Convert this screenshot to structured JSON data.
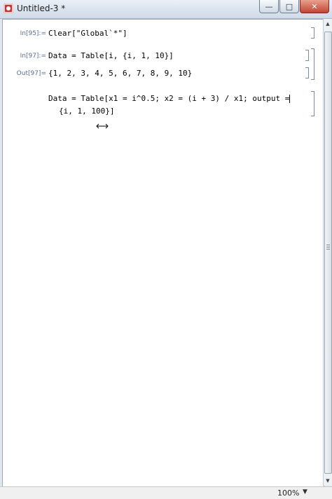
{
  "window": {
    "title": "Untitled-3 *"
  },
  "controls": {
    "minimize": "—",
    "maximize": "□",
    "close": "✕"
  },
  "cells": [
    {
      "label": "In[95]:=",
      "code": "Clear[\"Global`*\"]"
    },
    {
      "label": "In[97]:=",
      "code": "Data = Table[i, {i, 1, 10}]"
    },
    {
      "label": "Out[97]=",
      "code": "{1, 2, 3, 4, 5, 6, 7, 8, 9, 10}"
    },
    {
      "label": "",
      "line1": "Data = Table[x1 = i^0.5; x2 = (i + 3) / x1; output =",
      "line2": "{i, 1, 100}]"
    }
  ],
  "status": {
    "zoom": "100%"
  }
}
